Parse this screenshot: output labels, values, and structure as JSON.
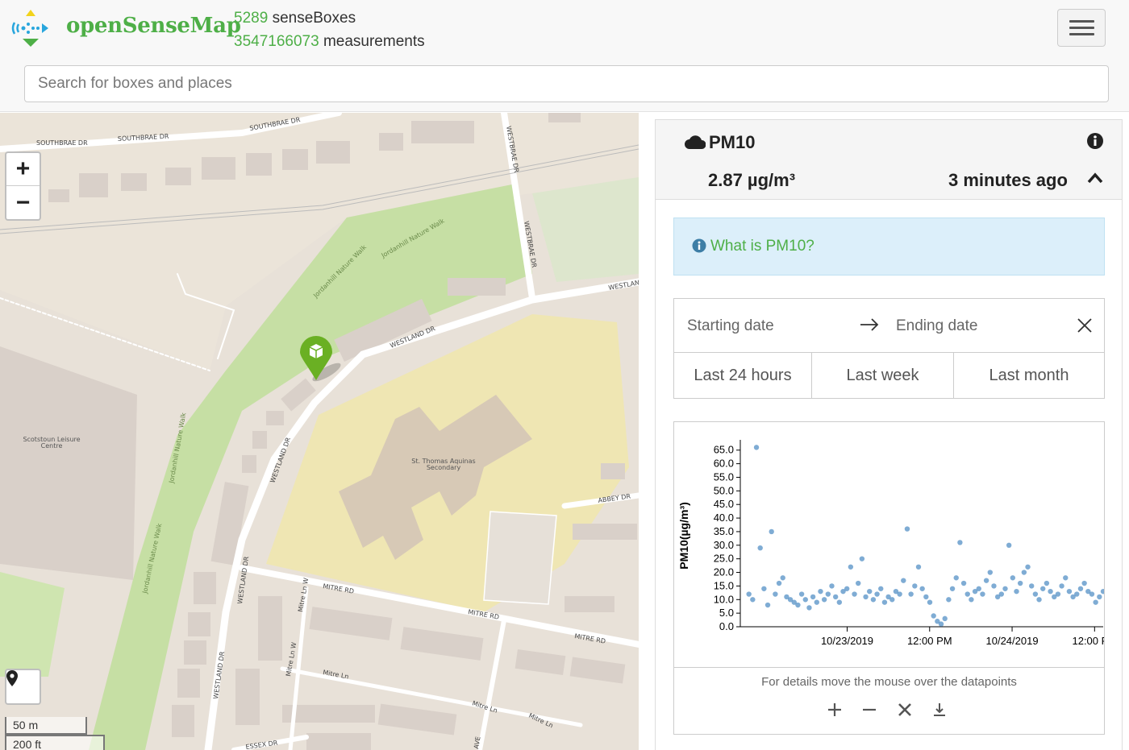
{
  "header": {
    "brand": "openSenseMap",
    "box_count": "5289",
    "box_label": "senseBoxes",
    "measurement_count": "3547166073",
    "measurement_label": "measurements",
    "menu_icon": "hamburger-icon"
  },
  "search": {
    "placeholder": "Search for boxes and places"
  },
  "map": {
    "streets": [
      "SOUTHBRAE DR",
      "SOUTHBRAE DR",
      "SOUTHBRAE DR",
      "WESTBRAE DR",
      "WESTBRAE DR",
      "WESTLAN",
      "WESTLAND DR",
      "WESTLAND DR",
      "WESTLAND DR",
      "WESTLAND DR",
      "ABBEY DR",
      "MITRE RD",
      "MITRE RD",
      "MITRE RD",
      "Mitre Ln",
      "Mitre Ln",
      "Mitre Ln",
      "Mitre Ln W",
      "Mitre Ln W",
      "ESSEX DR",
      "AVE",
      "Jordanhill Nature Walk",
      "Jordanhill Nature Walk",
      "Jordanhill Nature Walk",
      "Jordanhill Nature Walk"
    ],
    "places": {
      "leisure": [
        "Scotstoun Leisure",
        "Centre"
      ],
      "school": [
        "St. Thomas Aquinas",
        "Secondary"
      ]
    },
    "zoom_in": "+",
    "zoom_out": "−",
    "scale_metric": "50 m",
    "scale_imperial": "200 ft",
    "colors": {
      "background": "#e8e1d8",
      "park": "#c6dfa4",
      "school": "#efe6b3",
      "building": "#d9d0c9",
      "marker": "#6ab023"
    }
  },
  "panel": {
    "title": "PM10",
    "value": "2.87 µg/m³",
    "time_ago": "3 minutes ago",
    "info_link": "What is PM10?",
    "start_placeholder": "Starting date",
    "end_placeholder": "Ending date",
    "range_buttons": [
      "Last 24 hours",
      "Last week",
      "Last month"
    ],
    "chart_hint": "For details move the mouse over the datapoints",
    "tools": [
      "zoom-in-icon",
      "zoom-out-icon",
      "reset-icon",
      "download-icon"
    ]
  },
  "chart_data": {
    "type": "scatter",
    "title": "",
    "ylabel": "PM10(µg/m³)",
    "xlabel": "",
    "ylim": [
      0,
      67
    ],
    "yticks": [
      "65.0",
      "60.0",
      "55.0",
      "50.0",
      "45.0",
      "40.0",
      "35.0",
      "30.0",
      "25.0",
      "20.0",
      "15.0",
      "10.0",
      "5.0",
      "0.0"
    ],
    "xticks": [
      "10/23/2019",
      "12:00 PM",
      "10/24/2019",
      "12:00 PM"
    ],
    "color": "#3a7fbd",
    "x": [
      0.02,
      0.04,
      0.06,
      0.08,
      0.1,
      0.12,
      0.14,
      0.16,
      0.18,
      0.2,
      0.22,
      0.24,
      0.26,
      0.28,
      0.3,
      0.32,
      0.34,
      0.36,
      0.38,
      0.4,
      0.42,
      0.44,
      0.46,
      0.48,
      0.5,
      0.52,
      0.54,
      0.56,
      0.58,
      0.6,
      0.62,
      0.64,
      0.66,
      0.68,
      0.7,
      0.72,
      0.74,
      0.76,
      0.78,
      0.8,
      0.82,
      0.84,
      0.86,
      0.88,
      0.9,
      0.92,
      0.94,
      0.96,
      0.98,
      1.0,
      1.02,
      1.04,
      1.06,
      1.08,
      1.1,
      1.12,
      1.14,
      1.16,
      1.18,
      1.2,
      1.22,
      1.24,
      1.26,
      1.28,
      1.3,
      1.32,
      1.34,
      1.36,
      1.38,
      1.4,
      1.42,
      1.44,
      1.46,
      1.48,
      1.5,
      1.52,
      1.54,
      1.56,
      1.58,
      1.6,
      1.62,
      1.64,
      1.66,
      1.68,
      1.7,
      1.72,
      1.74,
      1.76,
      1.78,
      1.8,
      1.82,
      1.84,
      1.86,
      1.88,
      1.9,
      1.92,
      1.94,
      1.96,
      1.98
    ],
    "y": [
      12,
      10,
      66,
      29,
      14,
      8,
      35,
      12,
      16,
      18,
      11,
      10,
      9,
      8,
      12,
      10,
      7,
      11,
      9,
      13,
      10,
      12,
      15,
      11,
      9,
      13,
      14,
      22,
      12,
      16,
      25,
      11,
      13,
      10,
      12,
      14,
      9,
      11,
      10,
      13,
      12,
      17,
      36,
      12,
      15,
      22,
      14,
      11,
      9,
      4,
      2,
      1,
      3,
      10,
      14,
      18,
      31,
      16,
      12,
      10,
      13,
      14,
      12,
      17,
      20,
      15,
      11,
      12,
      14,
      30,
      18,
      13,
      16,
      20,
      22,
      15,
      12,
      10,
      14,
      16,
      13,
      11,
      12,
      15,
      18,
      13,
      11,
      12,
      14,
      16,
      13,
      12,
      9,
      11,
      13,
      12,
      14,
      10,
      9
    ]
  }
}
